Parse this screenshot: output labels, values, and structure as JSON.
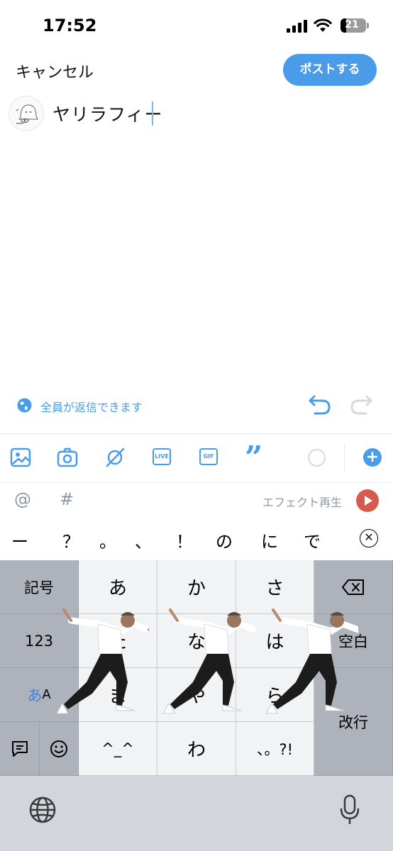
{
  "status": {
    "time": "17:52",
    "battery": "21"
  },
  "header": {
    "cancel_label": "キャンセル",
    "post_label": "ポストする"
  },
  "compose": {
    "text": "ヤリラフィー"
  },
  "reply_setting": {
    "label": "全員が返信できます"
  },
  "toolbar": {
    "icons": [
      "image-icon",
      "camera-icon",
      "no-wifi-icon",
      "live-icon",
      "gif-icon",
      "quote-icon",
      "char-count-ring",
      "add-thread-icon"
    ],
    "live_label": "LIVE",
    "gif_label": "GIF",
    "accent": "#4a9be8"
  },
  "suggestion_bar": {
    "at": "@",
    "hash": "#",
    "effect_label": "エフェクト再生"
  },
  "candidates": [
    "ー",
    "？",
    "。",
    "、",
    "！",
    "の",
    "に",
    "で"
  ],
  "keyboard": {
    "row1": {
      "left": "記号",
      "keys": [
        "あ",
        "か",
        "さ"
      ]
    },
    "row2": {
      "left": "123",
      "keys": [
        "た",
        "な",
        "は"
      ],
      "right": "空白"
    },
    "row3": {
      "left_kana": "あ",
      "left_latin": "A",
      "keys": [
        "ま",
        "や",
        "ら"
      ],
      "right": "改行"
    },
    "row4": {
      "keys": [
        "^_^",
        "わ",
        "、。?!"
      ]
    }
  }
}
